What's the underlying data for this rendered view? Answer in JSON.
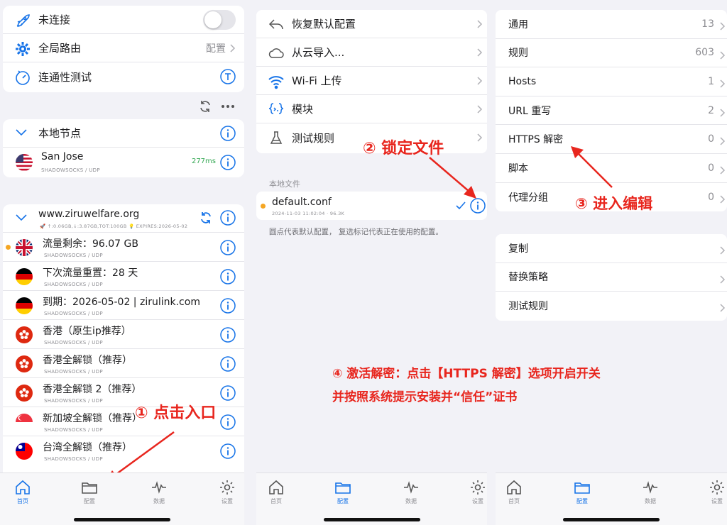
{
  "panel1": {
    "top_rows": [
      {
        "label": "未连接",
        "icon": "rocket-icon"
      },
      {
        "label": "全局路由",
        "value": "配置",
        "icon": "gear-icon"
      },
      {
        "label": "连通性测试",
        "icon": "gauge-icon"
      }
    ],
    "local_section": {
      "title": "本地节点"
    },
    "local_node": {
      "name": "San Jose",
      "protocol": "SHADOWSOCKS / UDP",
      "latency": "277ms"
    },
    "subscription": {
      "title": "www.ziruwelfare.org",
      "stats": "🚀 ↑:0.06GB,↓:3.87GB,TOT:100GB 💡 EXPIRES:2026-05-02"
    },
    "nodes": [
      {
        "name": "流量剩余：96.07 GB",
        "protocol": "SHADOWSOCKS / UDP",
        "flag": "uk"
      },
      {
        "name": "下次流量重置：28 天",
        "protocol": "SHADOWSOCKS / UDP",
        "flag": "de"
      },
      {
        "name": "到期：2026-05-02 | zirulink.com",
        "protocol": "SHADOWSOCKS / UDP",
        "flag": "de"
      },
      {
        "name": "香港（原生ip推荐）",
        "protocol": "SHADOWSOCKS / UDP",
        "flag": "hk"
      },
      {
        "name": "香港全解锁（推荐）",
        "protocol": "SHADOWSOCKS / UDP",
        "flag": "hk"
      },
      {
        "name": "香港全解锁 2（推荐）",
        "protocol": "SHADOWSOCKS / UDP",
        "flag": "hk"
      },
      {
        "name": "新加坡全解锁（推荐）",
        "protocol": "SHADOWSOCKS / UDP",
        "flag": "sg"
      },
      {
        "name": "台湾全解锁（推荐）",
        "protocol": "SHADOWSOCKS / UDP",
        "flag": "tw"
      }
    ],
    "annotation": "① 点击入口"
  },
  "panel2": {
    "rows": [
      {
        "label": "恢复默认配置",
        "icon": "undo-icon"
      },
      {
        "label": "从云导入...",
        "icon": "cloud-icon"
      },
      {
        "label": "Wi-Fi 上传",
        "icon": "wifi-icon"
      },
      {
        "label": "模块",
        "icon": "module-icon"
      },
      {
        "label": "测试规则",
        "icon": "flask-icon"
      }
    ],
    "local_files_header": "本地文件",
    "file": {
      "name": "default.conf",
      "meta": "2024-11-03 11:02:04 · 96.3K"
    },
    "footer_note": "圆点代表默认配置， 复选标记代表正在使用的配置。",
    "annotation": "② 锁定文件"
  },
  "panel3": {
    "rows": [
      {
        "label": "通用",
        "value": "13"
      },
      {
        "label": "规则",
        "value": "603"
      },
      {
        "label": "Hosts",
        "value": "1"
      },
      {
        "label": "URL 重写",
        "value": "2"
      },
      {
        "label": "HTTPS 解密",
        "value": "0"
      },
      {
        "label": "脚本",
        "value": "0"
      },
      {
        "label": "代理分组",
        "value": "0"
      }
    ],
    "rows2": [
      {
        "label": "复制"
      },
      {
        "label": "替换策略"
      },
      {
        "label": "测试规则"
      }
    ],
    "annotation": "③ 进入编辑"
  },
  "annotation4": {
    "line1": "④ 激活解密：点击【HTTPS 解密】选项开启开关",
    "line2": "并按照系统提示安装并“信任”证书"
  },
  "tabs": [
    {
      "label": "首页",
      "icon": "home-icon"
    },
    {
      "label": "配置",
      "icon": "folder-icon"
    },
    {
      "label": "数据",
      "icon": "activity-icon"
    },
    {
      "label": "设置",
      "icon": "settings-icon"
    }
  ],
  "colors": {
    "accent": "#1673e8",
    "annotation": "#e8261e",
    "latency": "#34a853",
    "default_dot": "#f5a623"
  }
}
